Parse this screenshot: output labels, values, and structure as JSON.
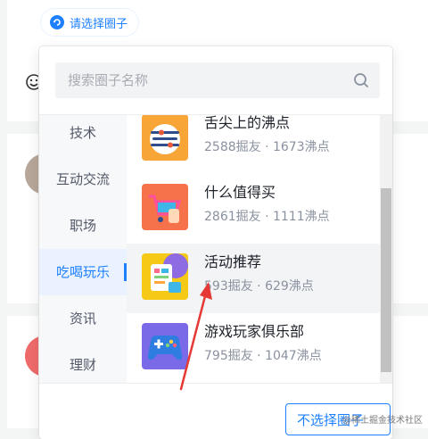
{
  "selector": {
    "label": "请选择圈子",
    "icon": "circle-refresh-icon"
  },
  "search": {
    "placeholder": "搜索圈子名称",
    "value": "",
    "icon": "search-icon"
  },
  "categories": [
    {
      "label": "技术",
      "active": false
    },
    {
      "label": "互动交流",
      "active": false
    },
    {
      "label": "职场",
      "active": false
    },
    {
      "label": "吃喝玩乐",
      "active": true
    },
    {
      "label": "资讯",
      "active": false
    },
    {
      "label": "理财",
      "active": false
    }
  ],
  "circles": [
    {
      "name": "舌尖上的沸点",
      "stats": "2588掘友 · 1673沸点",
      "icon": "food-plate-icon"
    },
    {
      "name": "什么值得买",
      "stats": "2861掘友 · 1111沸点",
      "icon": "shopping-cart-icon"
    },
    {
      "name": "活动推荐",
      "stats": "593掘友 · 629沸点",
      "icon": "activity-board-icon",
      "hovered": true
    },
    {
      "name": "游戏玩家俱乐部",
      "stats": "795掘友 · 1047沸点",
      "icon": "gamepad-icon"
    }
  ],
  "footer": {
    "none_label": "不选择圈子"
  },
  "watermark": "@稀土掘金技术社区",
  "colors": {
    "accent": "#1e80ff",
    "annotation": "#e53935"
  }
}
